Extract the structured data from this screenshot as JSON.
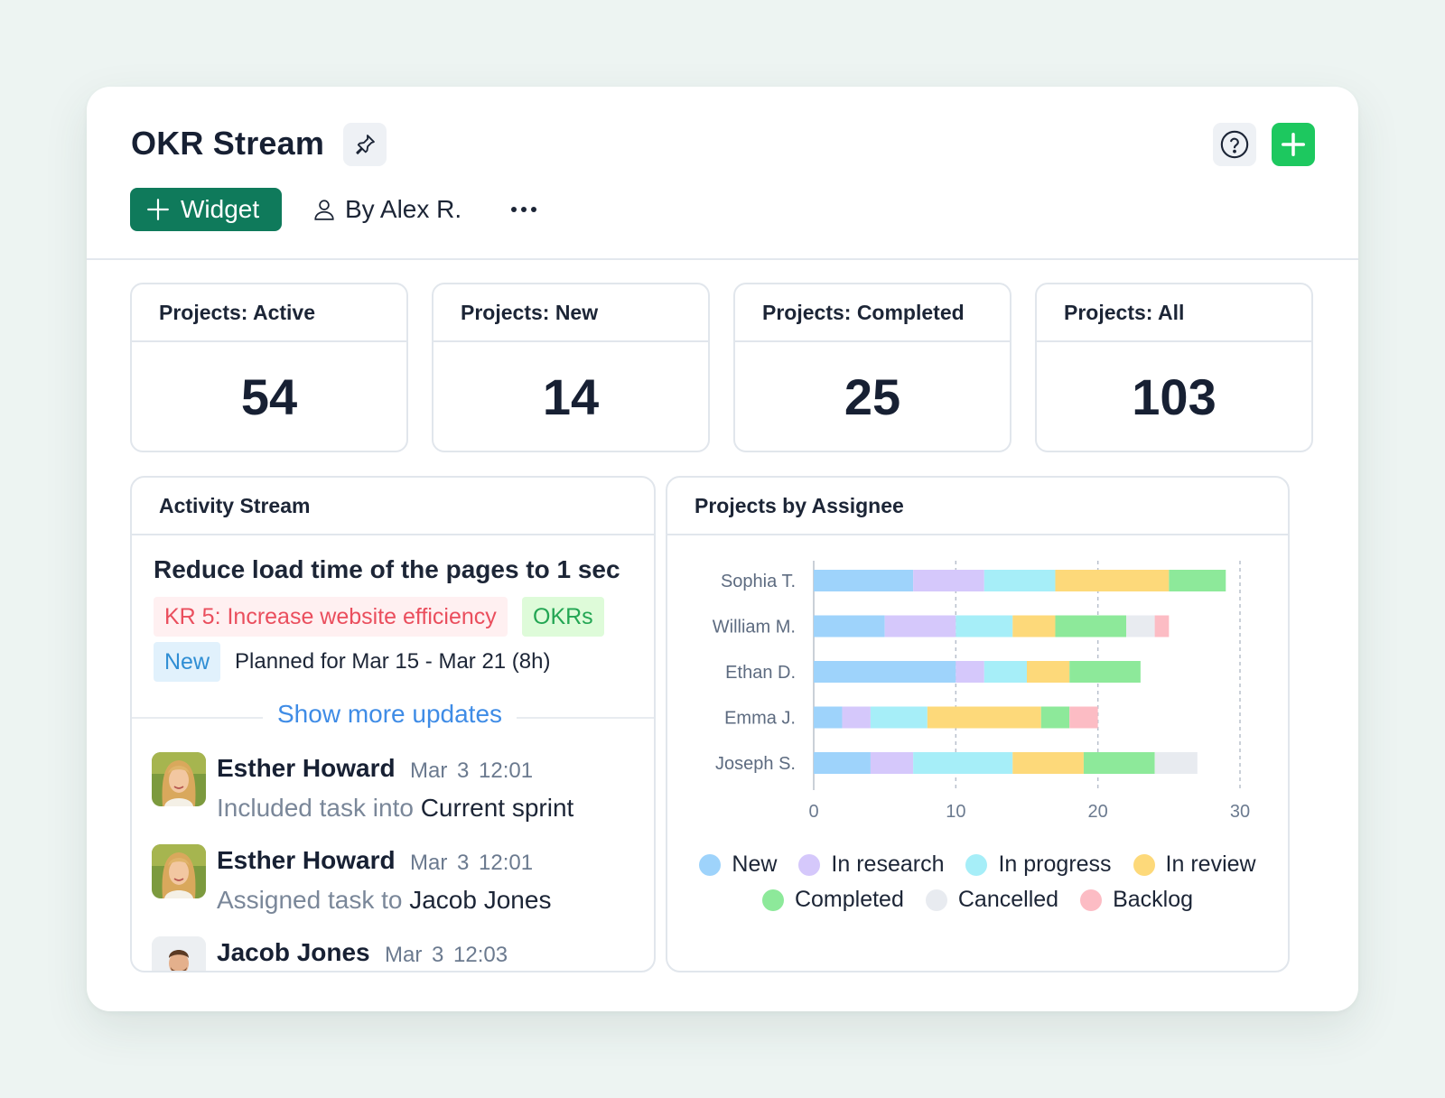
{
  "header": {
    "title": "OKR Stream",
    "widget_label": "Widget",
    "author_label": "By Alex R.",
    "icons": {
      "pin": "pin-icon",
      "help": "help-icon",
      "add": "plus-icon",
      "more": "more-dots-icon",
      "user": "user-icon"
    },
    "add_button_color": "#1dc85f",
    "widget_button_color": "#0f7a5b"
  },
  "stats": [
    {
      "label": "Projects: Active",
      "value": "54"
    },
    {
      "label": "Projects: New",
      "value": "14"
    },
    {
      "label": "Projects: Completed",
      "value": "25"
    },
    {
      "label": "Projects: All",
      "value": "103"
    }
  ],
  "activity": {
    "title": "Activity Stream",
    "task_title": "Reduce load time of the pages to 1 sec",
    "kr_tag": "KR 5: Increase website efficiency",
    "okr_tag": "OKRs",
    "status_tag": "New",
    "planned": "Planned for Mar 15 - Mar 21 (8h)",
    "show_more": "Show more updates",
    "updates": [
      {
        "name": "Esther Howard",
        "time": "Mar 3  12:01",
        "action": "Included task into",
        "target": "Current sprint"
      },
      {
        "name": "Esther Howard",
        "time": "Mar 3  12:01",
        "action": "Assigned task to",
        "target": "Jacob Jones"
      },
      {
        "name": "Jacob Jones",
        "time": "Mar 3  12:03",
        "action": "",
        "target": ""
      }
    ]
  },
  "assignee_panel": {
    "title": "Projects by Assignee"
  },
  "chart_data": {
    "type": "bar",
    "orientation": "horizontal",
    "stacked": true,
    "categories": [
      "Sophia T.",
      "William M.",
      "Ethan D.",
      "Emma J.",
      "Joseph S."
    ],
    "x_ticks": [
      "0",
      "10",
      "20",
      "30"
    ],
    "xlim": [
      0,
      30
    ],
    "grid": "vertical dashed",
    "legend_position": "bottom",
    "series": [
      {
        "name": "New",
        "color": "#9ed3fb",
        "values": [
          7,
          5,
          10,
          2,
          4
        ]
      },
      {
        "name": "In research",
        "color": "#d5c8fb",
        "values": [
          5,
          5,
          2,
          2,
          3
        ]
      },
      {
        "name": "In progress",
        "color": "#a6eef8",
        "values": [
          5,
          4,
          3,
          4,
          7
        ]
      },
      {
        "name": "In review",
        "color": "#fdd97a",
        "values": [
          8,
          3,
          3,
          8,
          5
        ]
      },
      {
        "name": "Completed",
        "color": "#8de99a",
        "values": [
          4,
          5,
          5,
          2,
          5
        ]
      },
      {
        "name": "Cancelled",
        "color": "#e8ebf0",
        "values": [
          0,
          2,
          0,
          0,
          3
        ]
      },
      {
        "name": "Backlog",
        "color": "#fcbcc4",
        "values": [
          0,
          1,
          0,
          2,
          0
        ]
      }
    ]
  }
}
